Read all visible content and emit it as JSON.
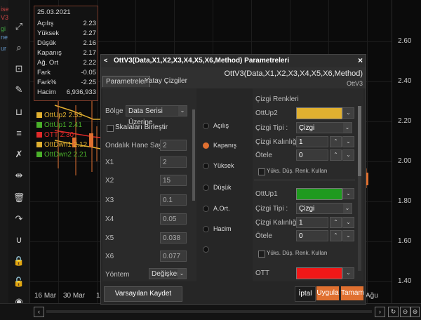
{
  "edge_labels": [
    "ise",
    "V3",
    "gi",
    "ne",
    "ur"
  ],
  "toolbar": {
    "icons": [
      "expand-icon",
      "zoom-icon",
      "crosshair-icon",
      "draw-icon",
      "ruler-icon",
      "fibonacci-icon",
      "tools-icon",
      "measure-icon",
      "delete-icon",
      "redo-icon",
      "magnet-icon",
      "lock-icon",
      "unlock-icon",
      "eye-icon"
    ]
  },
  "y_axis": {
    "ticks": [
      "2.60",
      "2.40",
      "2.20",
      "2.00",
      "1.80",
      "1.60",
      "1.40"
    ]
  },
  "x_axis": {
    "ticks": [
      "16 Mar",
      "30 Mar",
      "1",
      "Ağu"
    ]
  },
  "info": {
    "date": "25.03.2021",
    "rows": [
      {
        "k": "Açılış",
        "v": "2.23"
      },
      {
        "k": "Yüksek",
        "v": "2.27"
      },
      {
        "k": "Düşük",
        "v": "2.16"
      },
      {
        "k": "Kapanış",
        "v": "2.17"
      },
      {
        "k": "Ağ. Ort",
        "v": "2.22"
      },
      {
        "k": "Fark",
        "v": "-0.05"
      },
      {
        "k": "Fark%",
        "v": "-2.25"
      },
      {
        "k": "Hacim",
        "v": "6,936,933"
      }
    ]
  },
  "legend": [
    {
      "label": "OttUp2 2.53",
      "color": "#e0b030"
    },
    {
      "label": "OttUp1 2.41",
      "color": "#4ab02a"
    },
    {
      "label": "OTT 2.30",
      "color": "#e02a2a"
    },
    {
      "label": "OttDwn1 2.12",
      "color": "#e0b030"
    },
    {
      "label": "OttDwn2 2.21",
      "color": "#4ab02a"
    }
  ],
  "dialog": {
    "title": "OttV3(Data,X1,X2,X3,X4,X5,X6,Method) Parametreleri",
    "close": "×",
    "header_title": "OttV3(Data,X1,X2,X3,X4,X5,X6,Method)",
    "header_sub": "OttV3",
    "tabs": [
      "Parametreler",
      "Yatay Çizgiler"
    ],
    "bolge_label": "Bölge :",
    "bolge_value": "Data Serisi Üzerine",
    "skala_label": "Skalaları Birleştir",
    "ondalik_label": "Ondalık Hane Sayısı :",
    "ondalik_value": "2",
    "params": [
      {
        "k": "X1",
        "v": "2"
      },
      {
        "k": "X2",
        "v": "15"
      },
      {
        "k": "X3",
        "v": "0.1"
      },
      {
        "k": "X4",
        "v": "0.05"
      },
      {
        "k": "X5",
        "v": "0.038"
      },
      {
        "k": "X6",
        "v": "0.077"
      }
    ],
    "yontem_label": "Yöntem",
    "yontem_value": "Değişken",
    "data_options": [
      "Açılış",
      "Kapanış",
      "Yüksek",
      "Düşük",
      "A.Ort.",
      "Hacim"
    ],
    "selected_option": "Kapanış",
    "renk_title": "Çizgi Renkleri",
    "lines": [
      {
        "name": "OttUp2",
        "color": "#e0b030",
        "tip": "Çizgi",
        "kalinlik": "1",
        "otele": "0",
        "yuks": "Yüks. Düş. Renk. Kullan"
      },
      {
        "name": "OttUp1",
        "color": "#1f9a1f",
        "tip": "Çizgi",
        "kalinlik": "1",
        "otele": "0",
        "yuks": "Yüks. Düş. Renk. Kullan"
      },
      {
        "name": "OTT",
        "color": "#f01818"
      }
    ],
    "tip_label": "Çizgi Tipi :",
    "kalinlik_label": "Çizgi Kalınlığı :",
    "otele_label": "Ötele",
    "save_default": "Varsayılan Kaydet",
    "cancel": "İptal",
    "apply": "Uygula",
    "ok": "Tamam"
  },
  "colors": {
    "accent_orange": "#e07030"
  }
}
